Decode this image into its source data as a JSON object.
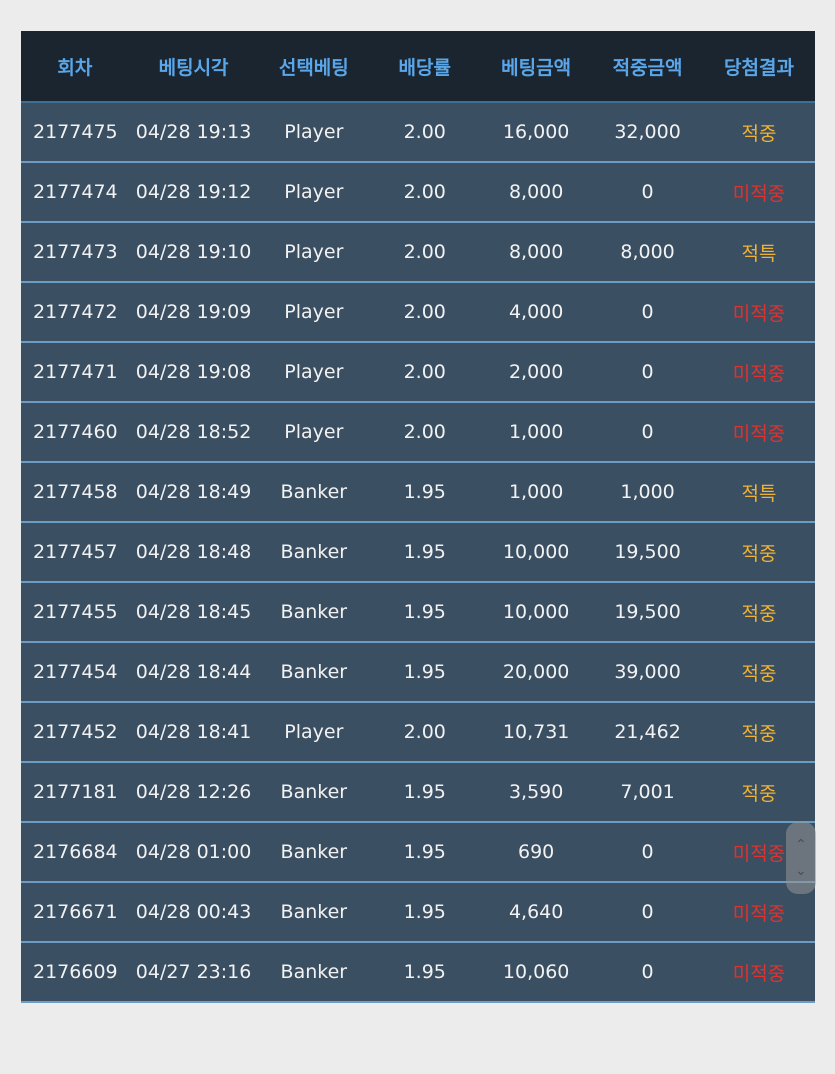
{
  "colors": {
    "header_bg": "#1a2530",
    "header_text": "#5ba6e8",
    "row_bg": "#3b4f62",
    "row_divider": "#6b9dc4",
    "win": "#f0b233",
    "lose": "#e0322e"
  },
  "headers": [
    "회차",
    "베팅시각",
    "선택베팅",
    "배당률",
    "베팅금액",
    "적중금액",
    "당첨결과"
  ],
  "rows": [
    {
      "round": "2177475",
      "time": "04/28 19:13",
      "pick": "Player",
      "odds": "2.00",
      "bet": "16,000",
      "payout": "32,000",
      "result": "적중",
      "status": "win"
    },
    {
      "round": "2177474",
      "time": "04/28 19:12",
      "pick": "Player",
      "odds": "2.00",
      "bet": "8,000",
      "payout": "0",
      "result": "미적중",
      "status": "lose"
    },
    {
      "round": "2177473",
      "time": "04/28 19:10",
      "pick": "Player",
      "odds": "2.00",
      "bet": "8,000",
      "payout": "8,000",
      "result": "적특",
      "status": "win"
    },
    {
      "round": "2177472",
      "time": "04/28 19:09",
      "pick": "Player",
      "odds": "2.00",
      "bet": "4,000",
      "payout": "0",
      "result": "미적중",
      "status": "lose"
    },
    {
      "round": "2177471",
      "time": "04/28 19:08",
      "pick": "Player",
      "odds": "2.00",
      "bet": "2,000",
      "payout": "0",
      "result": "미적중",
      "status": "lose"
    },
    {
      "round": "2177460",
      "time": "04/28 18:52",
      "pick": "Player",
      "odds": "2.00",
      "bet": "1,000",
      "payout": "0",
      "result": "미적중",
      "status": "lose"
    },
    {
      "round": "2177458",
      "time": "04/28 18:49",
      "pick": "Banker",
      "odds": "1.95",
      "bet": "1,000",
      "payout": "1,000",
      "result": "적특",
      "status": "win"
    },
    {
      "round": "2177457",
      "time": "04/28 18:48",
      "pick": "Banker",
      "odds": "1.95",
      "bet": "10,000",
      "payout": "19,500",
      "result": "적중",
      "status": "win"
    },
    {
      "round": "2177455",
      "time": "04/28 18:45",
      "pick": "Banker",
      "odds": "1.95",
      "bet": "10,000",
      "payout": "19,500",
      "result": "적중",
      "status": "win"
    },
    {
      "round": "2177454",
      "time": "04/28 18:44",
      "pick": "Banker",
      "odds": "1.95",
      "bet": "20,000",
      "payout": "39,000",
      "result": "적중",
      "status": "win"
    },
    {
      "round": "2177452",
      "time": "04/28 18:41",
      "pick": "Player",
      "odds": "2.00",
      "bet": "10,731",
      "payout": "21,462",
      "result": "적중",
      "status": "win"
    },
    {
      "round": "2177181",
      "time": "04/28 12:26",
      "pick": "Banker",
      "odds": "1.95",
      "bet": "3,590",
      "payout": "7,001",
      "result": "적중",
      "status": "win"
    },
    {
      "round": "2176684",
      "time": "04/28 01:00",
      "pick": "Banker",
      "odds": "1.95",
      "bet": "690",
      "payout": "0",
      "result": "미적중",
      "status": "lose"
    },
    {
      "round": "2176671",
      "time": "04/28 00:43",
      "pick": "Banker",
      "odds": "1.95",
      "bet": "4,640",
      "payout": "0",
      "result": "미적중",
      "status": "lose"
    },
    {
      "round": "2176609",
      "time": "04/27 23:16",
      "pick": "Banker",
      "odds": "1.95",
      "bet": "10,060",
      "payout": "0",
      "result": "미적중",
      "status": "lose"
    }
  ],
  "scroll_icons": {
    "up": "chevron-up-icon",
    "down": "chevron-down-icon"
  }
}
